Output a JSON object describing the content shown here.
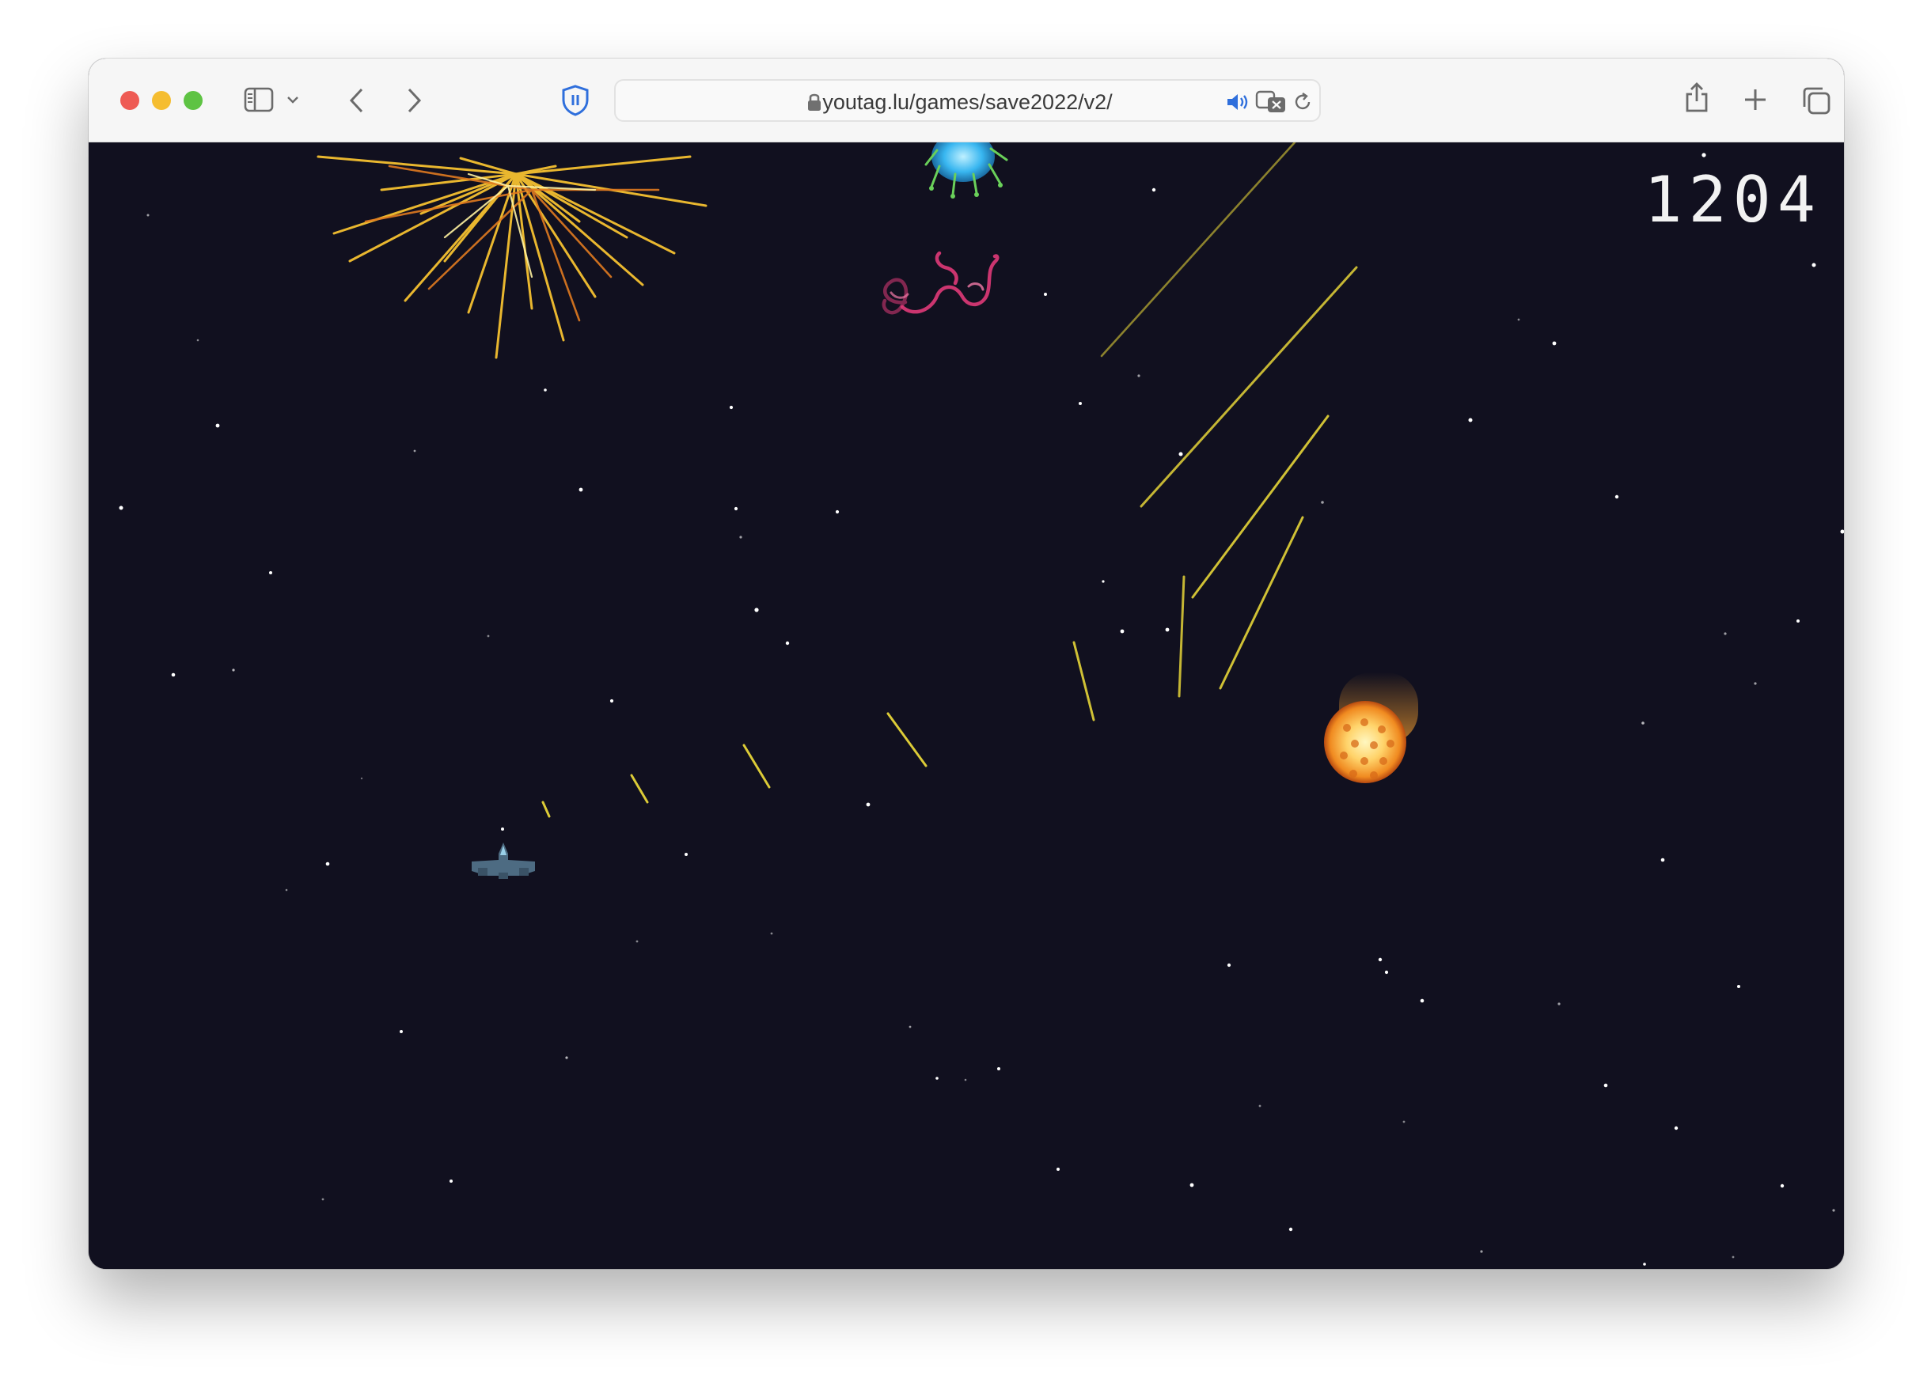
{
  "browser": {
    "url": "youtag.lu/games/save2022/v2/",
    "traffic_colors": {
      "close": "#ee5b54",
      "minimize": "#f5bd30",
      "maximize": "#5ec343"
    },
    "toolbar_icons": [
      "sidebar-icon",
      "chevron-down-icon",
      "back-icon",
      "forward-icon",
      "shield-icon",
      "lock-icon",
      "speaker-icon",
      "translate-icon",
      "reload-icon",
      "share-icon",
      "new-tab-icon",
      "tabs-overview-icon"
    ]
  },
  "game": {
    "score": "1204",
    "background_color": "#11101f",
    "colors": {
      "laser": "#f2e03a",
      "ship": "#4d6b82",
      "fireball": "#f7a030",
      "worm": "#e03a78",
      "spark": "#f5c030",
      "alien": "#38b6f0"
    }
  }
}
